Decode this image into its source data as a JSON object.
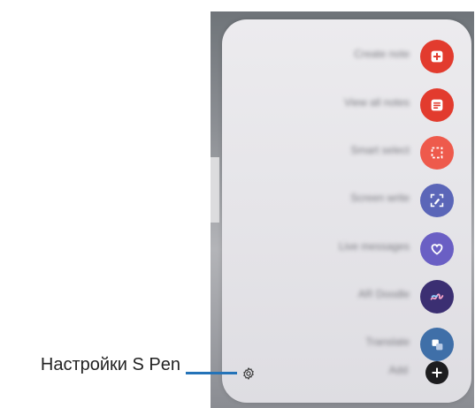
{
  "callout": {
    "label": "Настройки S Pen"
  },
  "menu": {
    "items": [
      {
        "label": "Create note",
        "icon": "create-note-icon",
        "color": "#e23b2e"
      },
      {
        "label": "View all notes",
        "icon": "view-all-notes-icon",
        "color": "#e23b2e"
      },
      {
        "label": "Smart select",
        "icon": "smart-select-icon",
        "color": "#ee5a4c"
      },
      {
        "label": "Screen write",
        "icon": "screen-write-icon",
        "color": "#5b66b8"
      },
      {
        "label": "Live messages",
        "icon": "live-messages-icon",
        "color": "#6a5fc4"
      },
      {
        "label": "AR Doodle",
        "icon": "ar-doodle-icon",
        "color": "#3b2f72"
      },
      {
        "label": "Translate",
        "icon": "translate-icon",
        "color": "#3f6fa8"
      },
      {
        "label": "Add",
        "icon": "add-icon",
        "color": "#1d1d1f"
      }
    ]
  }
}
